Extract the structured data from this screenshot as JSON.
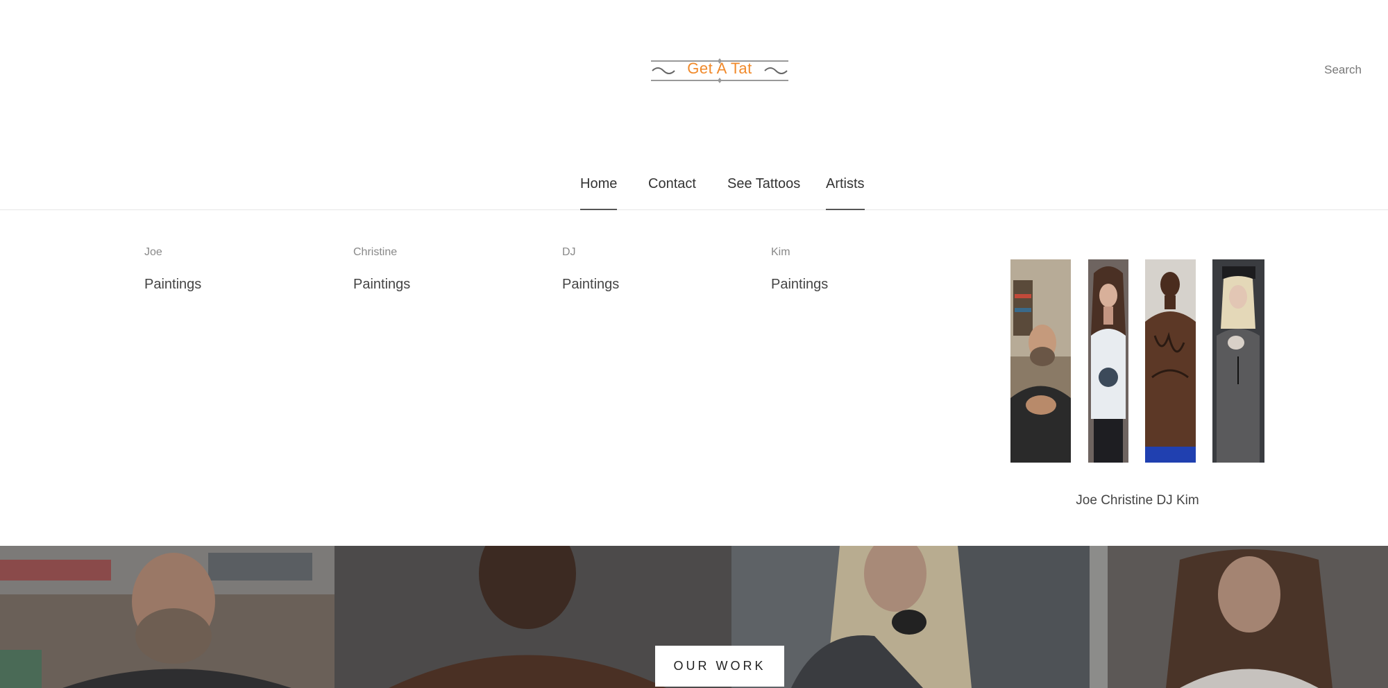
{
  "header": {
    "logo_text": "Get A Tat",
    "search_label": "Search"
  },
  "nav": {
    "items": [
      {
        "label": "Home"
      },
      {
        "label": "Contact"
      },
      {
        "label": "See Tattoos"
      },
      {
        "label": "Artists"
      }
    ]
  },
  "dropdown": {
    "artists": [
      {
        "name": "Joe",
        "link": "Paintings"
      },
      {
        "name": "Christine",
        "link": "Paintings"
      },
      {
        "name": "DJ",
        "link": "Paintings"
      },
      {
        "name": "Kim",
        "link": "Paintings"
      }
    ],
    "caption": "Joe Christine DJ Kim"
  },
  "hero": {
    "button_label": "OUR WORK"
  },
  "colors": {
    "logo_accent": "#f0892a",
    "text": "#333333",
    "nav_underline": "#555555"
  }
}
